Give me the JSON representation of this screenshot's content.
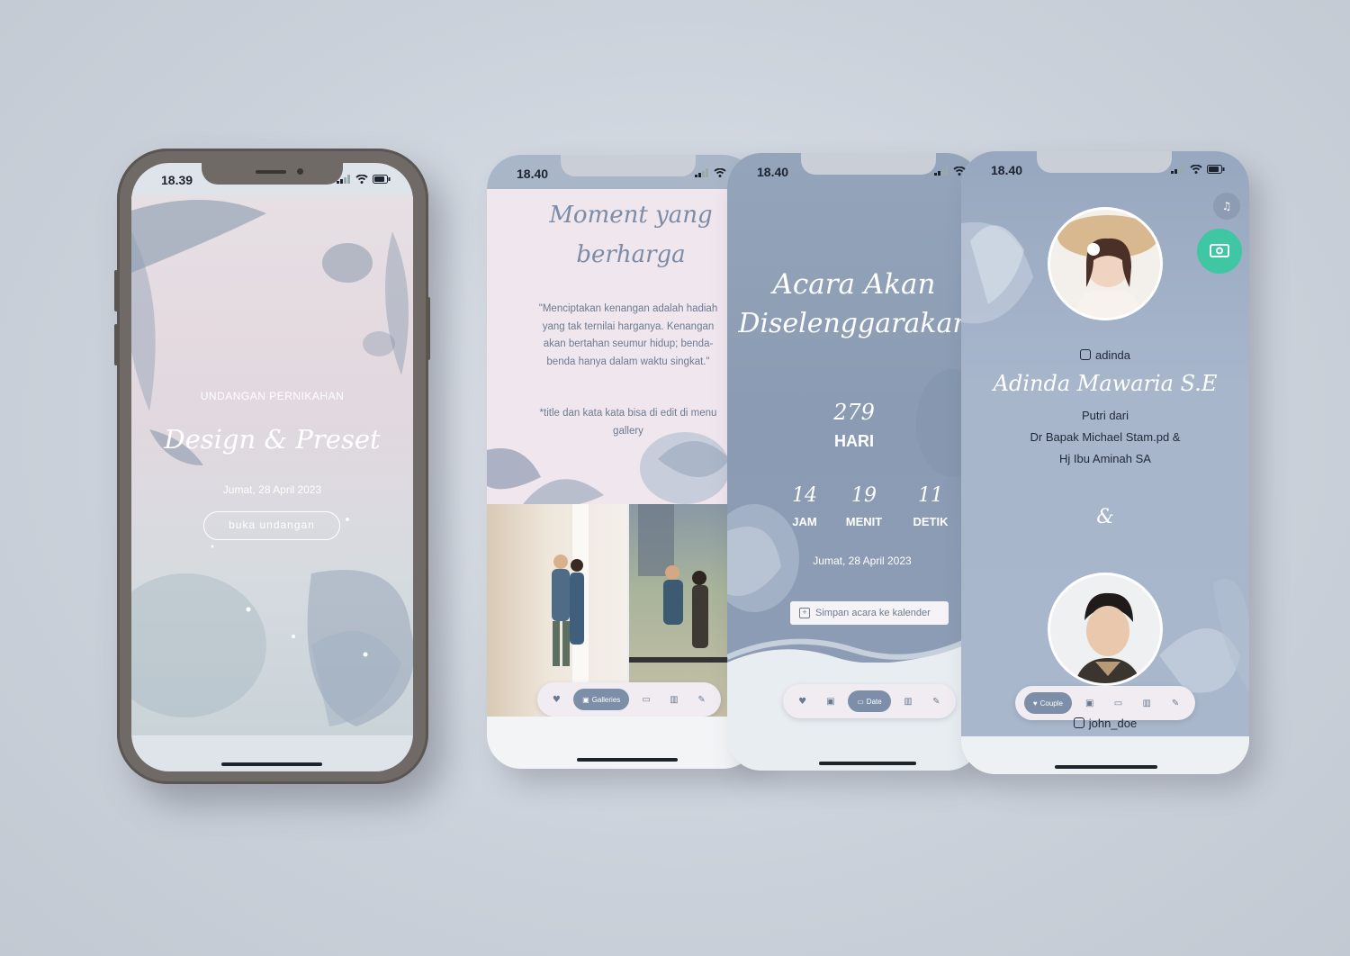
{
  "phone1": {
    "time": "18.39",
    "label": "UNDANGAN PERNIKAHAN",
    "title": "Design & Preset",
    "date": "Jumat, 28 April 2023",
    "open_button": "buka undangan"
  },
  "phone2": {
    "time": "18.40",
    "title_line1": "Moment yang",
    "title_line2": "berharga",
    "quote": "\"Menciptakan kenangan adalah hadiah yang tak ternilai harganya. Kenangan akan bertahan seumur hidup; benda-benda hanya dalam waktu singkat.\"",
    "note": "*title dan kata kata bisa di edit di menu gallery",
    "nav_active": "Galleries"
  },
  "phone3": {
    "time": "18.40",
    "title_line1": "Acara Akan",
    "title_line2": "Diselenggarakan",
    "days_value": "279",
    "days_label": "HARI",
    "hours_value": "14",
    "hours_label": "JAM",
    "minutes_value": "19",
    "minutes_label": "MENIT",
    "seconds_value": "11",
    "seconds_label": "DETIK",
    "date": "Jumat, 28 April 2023",
    "calendar_button": "Simpan acara ke kalender",
    "nav_active": "Date"
  },
  "phone4": {
    "time": "18.40",
    "instagram_bride": "adinda",
    "bride_name": "Adinda Mawaria S.E",
    "bride_child_of": "Putri dari",
    "bride_father": "Dr Bapak Michael Stam.pd &",
    "bride_mother": "Hj Ibu Aminah SA",
    "ampersand": "&",
    "instagram_groom": "john_doe",
    "nav_active": "Couple"
  },
  "colors": {
    "accent_blue": "#7d8ea8",
    "panel_blue": "#9aaac2",
    "teal_button": "#3fc6a2",
    "frame_grey": "#6f6a66"
  },
  "icons": [
    "wifi-icon",
    "battery-icon",
    "signal-icon",
    "heart-icon",
    "gallery-icon",
    "calendar-icon",
    "columns-icon",
    "edit-icon",
    "instagram-icon",
    "music-icon",
    "gift-icon"
  ]
}
